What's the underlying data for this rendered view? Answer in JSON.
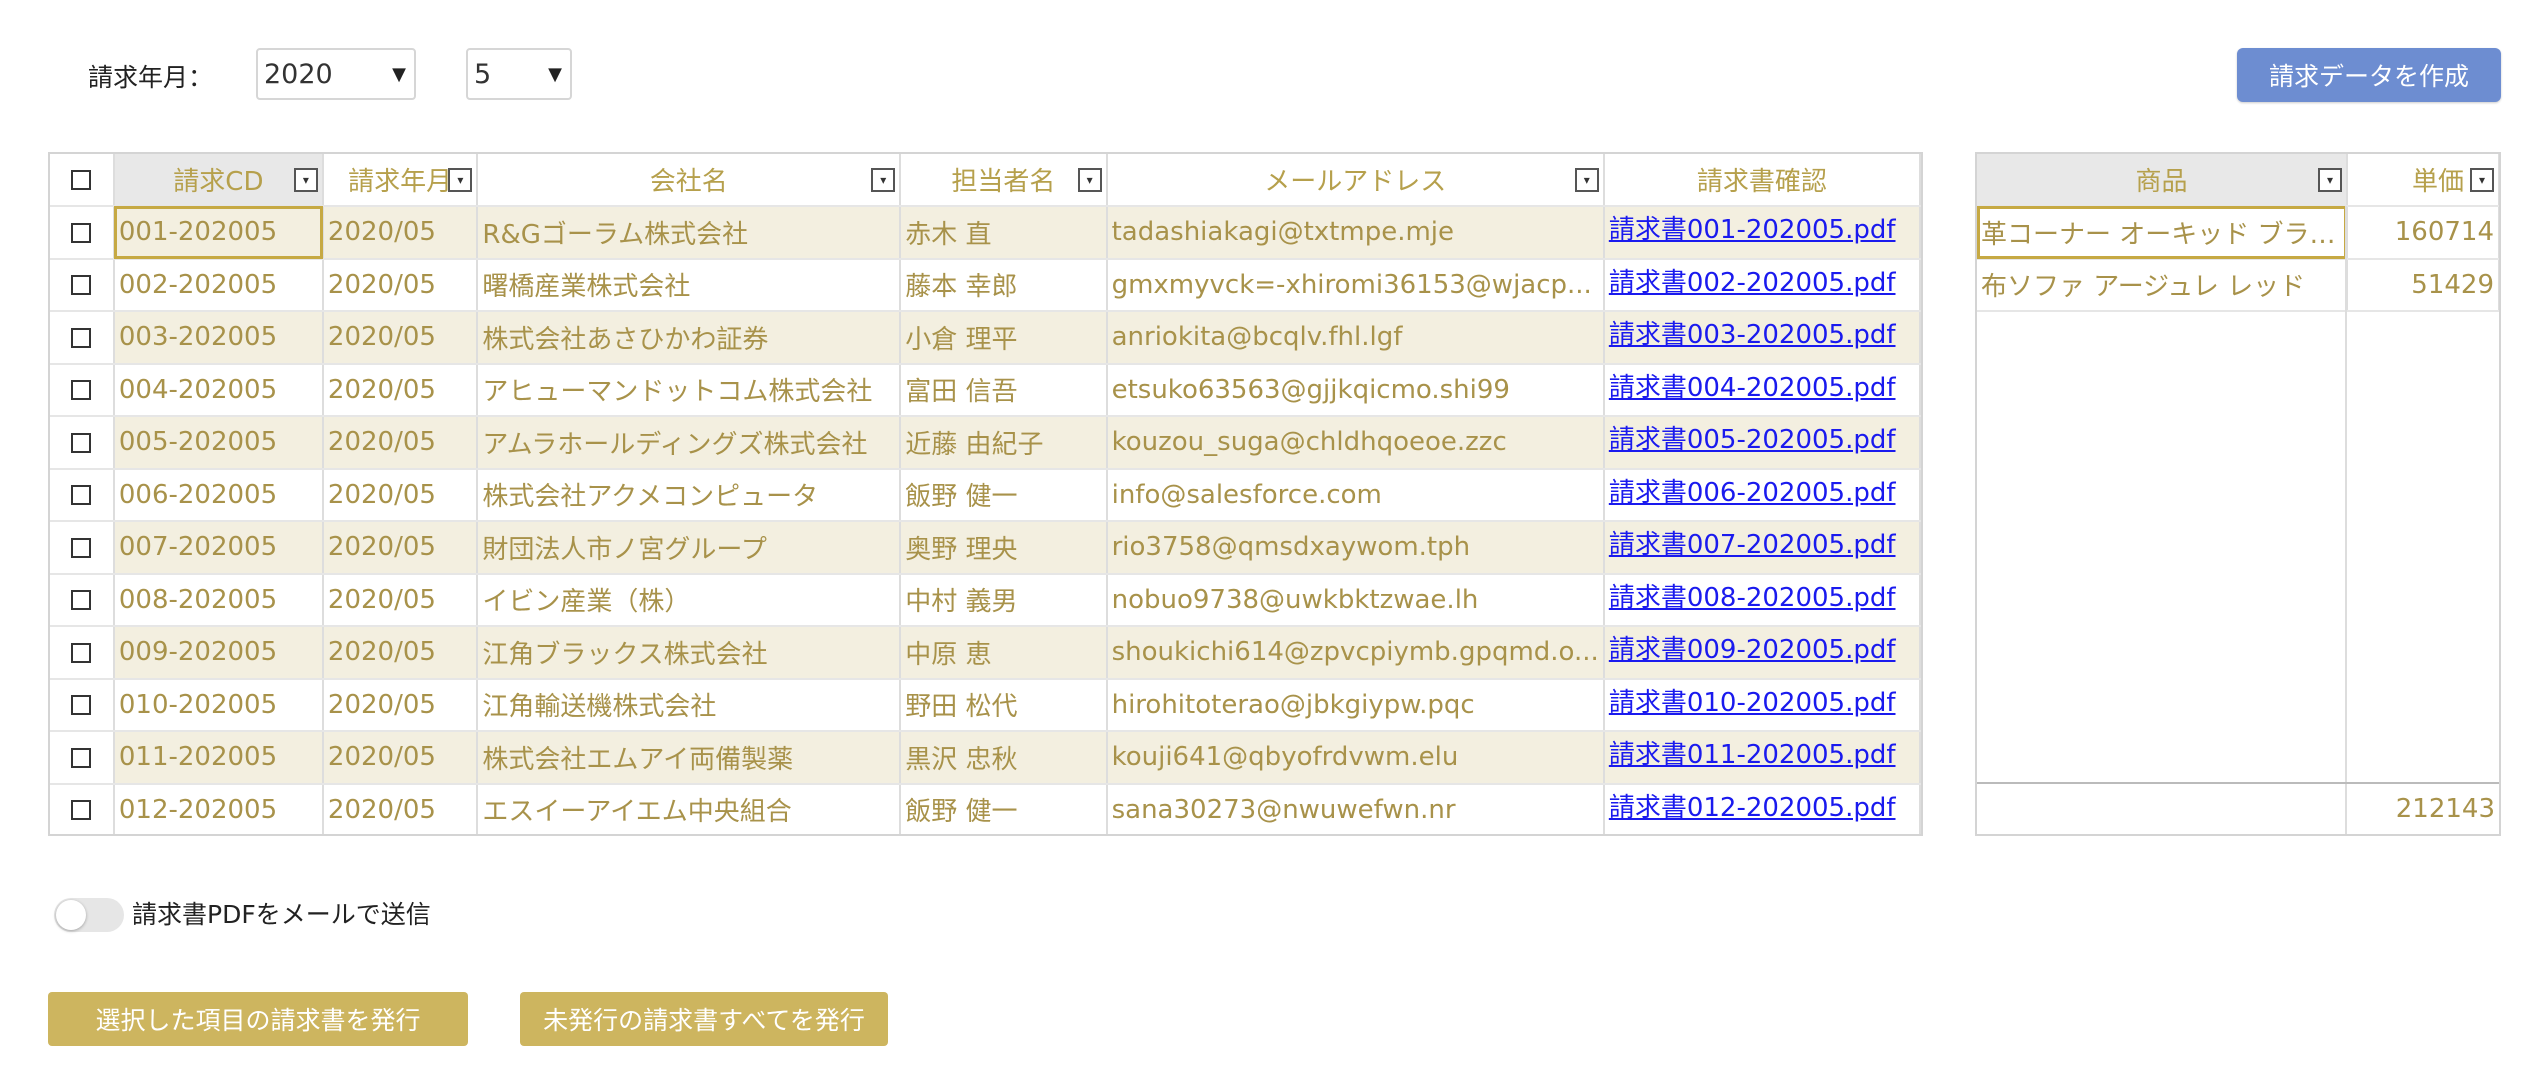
{
  "filter": {
    "label": "請求年月：",
    "year": "2020",
    "month": "5",
    "arrow": "▼"
  },
  "create_button": "請求データを作成",
  "grid": {
    "headers": [
      "請求CD",
      "請求年月",
      "会社名",
      "担当者名",
      "メールアドレス",
      "請求書確認"
    ],
    "dropdown_glyph": "▾",
    "rows": [
      {
        "cd": "001-202005",
        "ym": "2020/05",
        "company": "R&Gゴーラム株式会社",
        "person": "赤木 直",
        "email": "tadashiakagi@txtmpe.mje",
        "pdf": "請求書001-202005.pdf"
      },
      {
        "cd": "002-202005",
        "ym": "2020/05",
        "company": "曙橋産業株式会社",
        "person": "藤本 幸郎",
        "email": "gmxmyvck=-xhiromi36153@wjacp...",
        "pdf": "請求書002-202005.pdf"
      },
      {
        "cd": "003-202005",
        "ym": "2020/05",
        "company": "株式会社あさひかわ証券",
        "person": "小倉 理平",
        "email": "anriokita@bcqlv.fhl.lgf",
        "pdf": "請求書003-202005.pdf"
      },
      {
        "cd": "004-202005",
        "ym": "2020/05",
        "company": "アヒューマンドットコム株式会社",
        "person": "富田 信吾",
        "email": "etsuko63563@gjjkqicmo.shi99",
        "pdf": "請求書004-202005.pdf"
      },
      {
        "cd": "005-202005",
        "ym": "2020/05",
        "company": "アムラホールディングズ株式会社",
        "person": "近藤 由紀子",
        "email": "kouzou_suga@chldhqoeoe.zzc",
        "pdf": "請求書005-202005.pdf"
      },
      {
        "cd": "006-202005",
        "ym": "2020/05",
        "company": "株式会社アクメコンピュータ",
        "person": "飯野 健一",
        "email": "info@salesforce.com",
        "pdf": "請求書006-202005.pdf"
      },
      {
        "cd": "007-202005",
        "ym": "2020/05",
        "company": "財団法人市ノ宮グループ",
        "person": "奥野 理央",
        "email": "rio3758@qmsdxaywom.tph",
        "pdf": "請求書007-202005.pdf"
      },
      {
        "cd": "008-202005",
        "ym": "2020/05",
        "company": "イビン産業（株）",
        "person": "中村 義男",
        "email": "nobuo9738@uwkbktzwae.lh",
        "pdf": "請求書008-202005.pdf"
      },
      {
        "cd": "009-202005",
        "ym": "2020/05",
        "company": "江角ブラックス株式会社",
        "person": "中原 恵",
        "email": "shoukichi614@zpvcpiymb.gpqmd.o...",
        "pdf": "請求書009-202005.pdf"
      },
      {
        "cd": "010-202005",
        "ym": "2020/05",
        "company": "江角輸送機株式会社",
        "person": "野田 松代",
        "email": "hirohitoterao@jbkgiypw.pqc",
        "pdf": "請求書010-202005.pdf"
      },
      {
        "cd": "011-202005",
        "ym": "2020/05",
        "company": "株式会社エムアイ両備製薬",
        "person": "黒沢 忠秋",
        "email": "kouji641@qbyofrdvwm.elu",
        "pdf": "請求書011-202005.pdf"
      },
      {
        "cd": "012-202005",
        "ym": "2020/05",
        "company": "エスイーアイエム中央組合",
        "person": "飯野 健一",
        "email": "sana30273@nwuwefwn.nr",
        "pdf": "請求書012-202005.pdf"
      }
    ]
  },
  "side": {
    "headers": [
      "商品",
      "単価"
    ],
    "rows": [
      {
        "product": "革コーナー オーキッド ブラウン",
        "price": "160714"
      },
      {
        "product": "布ソファ アージュレ レッド",
        "price": "51429"
      }
    ],
    "total": "212143"
  },
  "toggle_label": "請求書PDFをメールで送信",
  "buttons": {
    "issue_selected": "選択した項目の請求書を発行",
    "issue_all": "未発行の請求書すべてを発行"
  }
}
